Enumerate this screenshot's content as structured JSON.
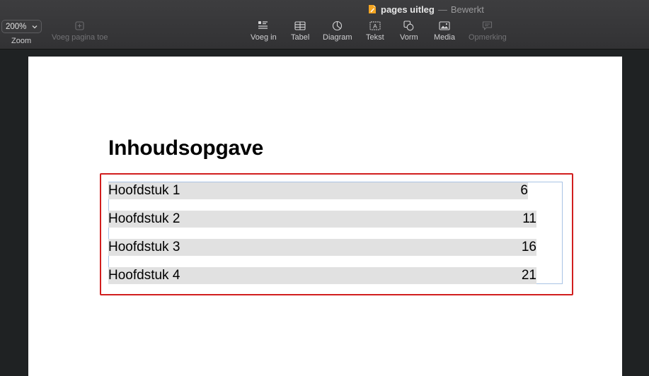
{
  "window": {
    "title": "pages uitleg",
    "separator": "—",
    "status": "Bewerkt"
  },
  "toolbar": {
    "zoom": {
      "value": "200%",
      "label": "Zoom"
    },
    "add_page": {
      "label": "Voeg pagina toe",
      "icon": "plus-square-icon",
      "enabled": false
    },
    "tools": [
      {
        "label": "Voeg in",
        "icon": "insert-list-icon",
        "enabled": true
      },
      {
        "label": "Tabel",
        "icon": "table-icon",
        "enabled": true
      },
      {
        "label": "Diagram",
        "icon": "pie-chart-icon",
        "enabled": true
      },
      {
        "label": "Tekst",
        "icon": "text-box-icon",
        "enabled": true
      },
      {
        "label": "Vorm",
        "icon": "shape-icon",
        "enabled": true
      },
      {
        "label": "Media",
        "icon": "photo-icon",
        "enabled": true
      },
      {
        "label": "Opmerking",
        "icon": "comment-icon",
        "enabled": false
      }
    ]
  },
  "document": {
    "heading": "Inhoudsopgave",
    "toc": [
      {
        "chapter": "Hoofdstuk 1",
        "page": "6"
      },
      {
        "chapter": "Hoofdstuk 2",
        "page": "11"
      },
      {
        "chapter": "Hoofdstuk 3",
        "page": "16"
      },
      {
        "chapter": "Hoofdstuk 4",
        "page": "21"
      }
    ]
  },
  "colors": {
    "highlight_border": "#d11e1e",
    "selection_fill": "#e1e1e1",
    "frame_border": "#a9c3e5",
    "pages_icon": "#f5a623"
  }
}
